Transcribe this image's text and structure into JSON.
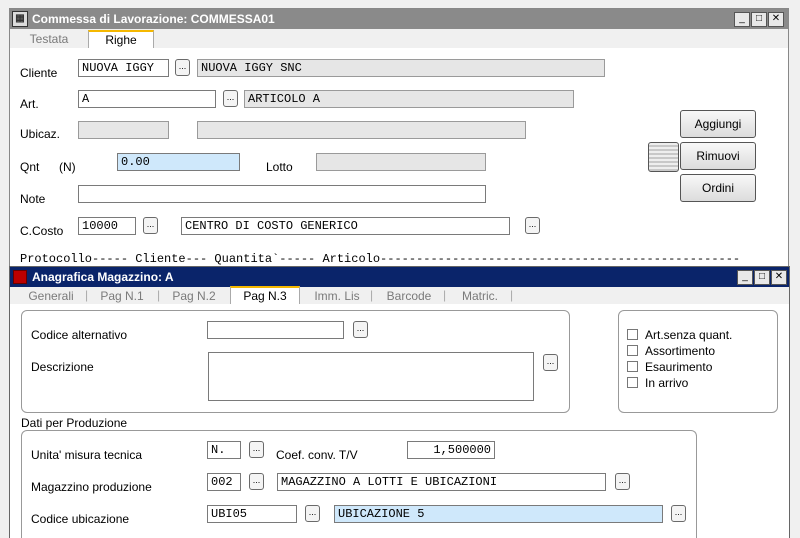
{
  "win1": {
    "title": "Commessa di Lavorazione: COMMESSA01",
    "tabs": [
      "Testata",
      "Righe"
    ],
    "labels": {
      "cliente": "Cliente",
      "art": "Art.",
      "ubicaz": "Ubicaz.",
      "qnt": "Qnt",
      "qnt_unit": "(N)",
      "lotto": "Lotto",
      "note": "Note",
      "ccosto": "C.Costo"
    },
    "values": {
      "cliente_code": "NUOVA IGGY",
      "cliente_desc": "NUOVA IGGY SNC",
      "art_code": "A",
      "art_desc": "ARTICOLO A",
      "ubicaz_code": "",
      "ubicaz_desc": "",
      "qnt": "0.00",
      "lotto": "",
      "note": "",
      "ccosto_code": "10000",
      "ccosto_desc": "CENTRO DI COSTO GENERICO"
    },
    "buttons": {
      "aggiungi": "Aggiungi",
      "rimuovi": "Rimuovi",
      "ordini": "Ordini"
    },
    "list_header": "Protocollo----- Cliente--- Quantita`----- Articolo---------------------------------------------------------------------------------"
  },
  "win2": {
    "title": "Anagrafica Magazzino: A",
    "tabs": [
      "Generali",
      "Pag N.1",
      "Pag N.2",
      "Pag N.3",
      "Imm. Lis",
      "Barcode",
      "Matric."
    ],
    "active_tab": "Pag N.3",
    "labels": {
      "codice_alternativo": "Codice alternativo",
      "descrizione": "Descrizione",
      "dati_produzione": "Dati per Produzione",
      "unita": "Unita' misura tecnica",
      "coef": "Coef. conv. T/V",
      "magazzino": "Magazzino produzione",
      "codice_ubicazione": "Codice ubicazione"
    },
    "checkboxes": [
      {
        "label": "Art.senza quant.",
        "checked": false
      },
      {
        "label": "Assortimento",
        "checked": false
      },
      {
        "label": "Esaurimento",
        "checked": false
      },
      {
        "label": "In arrivo",
        "checked": false
      }
    ],
    "values": {
      "codice_alternativo": "",
      "descrizione": "",
      "unita": "N.",
      "coef": "1,500000",
      "magazzino_code": "002",
      "magazzino_desc": "MAGAZZINO A LOTTI E UBICAZIONI",
      "ubicazione_code": "UBI05",
      "ubicazione_desc": "UBICAZIONE 5"
    }
  },
  "colors": {
    "titlebar_active": "#0a246a",
    "titlebar_inactive": "#808080",
    "tab_accent": "#f5b800",
    "highlight_field": "#cfe8fb"
  }
}
